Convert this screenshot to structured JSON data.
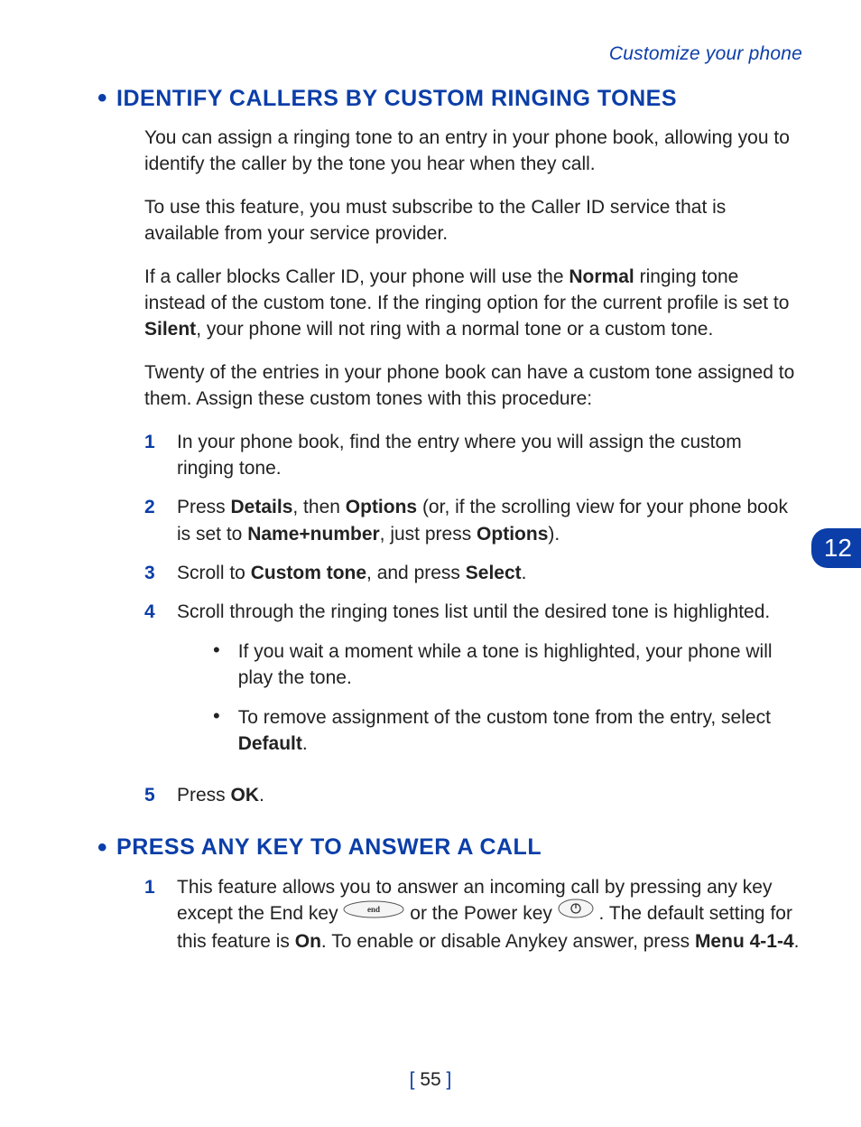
{
  "runningHeader": "Customize your phone",
  "sideTab": "12",
  "pageNumber": "55",
  "section1": {
    "title": "IDENTIFY CALLERS BY CUSTOM RINGING TONES",
    "p1": "You can assign a ringing tone to an entry in your phone book, allowing you to identify the caller by the tone you hear when they call.",
    "p2": "To use this feature, you must subscribe to the Caller ID service that is available from your service provider.",
    "p3_parts": {
      "a": "If a caller blocks Caller ID, your phone will use the ",
      "bold1": "Normal",
      "b": " ringing tone instead of the custom tone. If the ringing option for the current profile is set to ",
      "bold2": "Silent",
      "c": ", your phone will not ring with a normal tone or a custom tone."
    },
    "p4": "Twenty of the entries in your phone book can have a custom tone assigned to them. Assign these custom tones with this procedure:",
    "steps": {
      "s1": "In your phone book, find the entry where you will assign the custom ringing tone.",
      "s2": {
        "a": "Press ",
        "bold1": "Details",
        "b": ", then ",
        "bold2": "Options",
        "c": " (or, if the scrolling view for your phone book is set to ",
        "bold3": "Name+number",
        "d": ", just press ",
        "bold4": "Options",
        "e": ")."
      },
      "s3": {
        "a": "Scroll to ",
        "bold1": "Custom tone",
        "b": ", and press ",
        "bold2": "Select",
        "c": "."
      },
      "s4": {
        "text": "Scroll through the ringing tones list until the desired tone is highlighted.",
        "sub1": "If you wait a moment while a tone is highlighted, your phone will play the tone.",
        "sub2": {
          "a": "To remove assignment of the custom tone from the entry, select ",
          "bold1": "Default",
          "b": "."
        }
      },
      "s5": {
        "a": "Press ",
        "bold1": "OK",
        "b": "."
      }
    }
  },
  "section2": {
    "title": "PRESS ANY KEY TO ANSWER A CALL",
    "steps": {
      "s1": {
        "a": "This feature allows you to answer an incoming call by pressing any key except the End key ",
        "b": " or the Power key ",
        "c": ". The default setting for this feature is ",
        "bold1": "On",
        "d": ". To enable or disable Anykey answer, press ",
        "bold2": "Menu 4-1-4",
        "e": "."
      }
    }
  },
  "nums": {
    "n1": "1",
    "n2": "2",
    "n3": "3",
    "n4": "4",
    "n5": "5"
  }
}
